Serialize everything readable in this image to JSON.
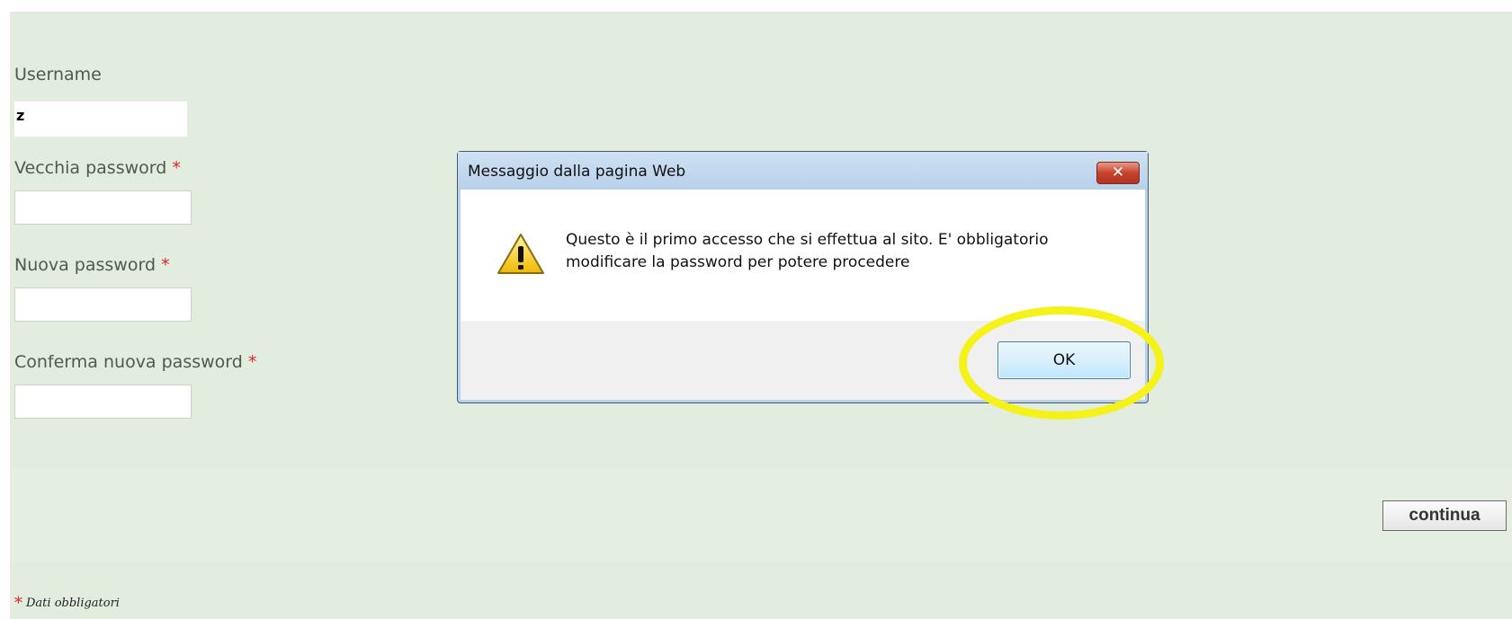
{
  "form": {
    "username_label": "Username",
    "username_value": "z",
    "old_password_label": "Vecchia password",
    "new_password_label": "Nuova password",
    "confirm_password_label": "Conferma nuova password",
    "required_marker": "*",
    "continue_label": "continua",
    "footnote_text": "Dati obbligatori"
  },
  "dialog": {
    "title": "Messaggio dalla pagina Web",
    "close_glyph": "✕",
    "message": "Questo è il primo accesso che si effettua al sito. E' obbligatorio modificare la password per potere procedere",
    "ok_label": "OK",
    "icon": "warning-icon"
  },
  "colors": {
    "panel_bg": "#e2ede0",
    "required": "#d9262a",
    "highlight": "#f5f21b"
  }
}
